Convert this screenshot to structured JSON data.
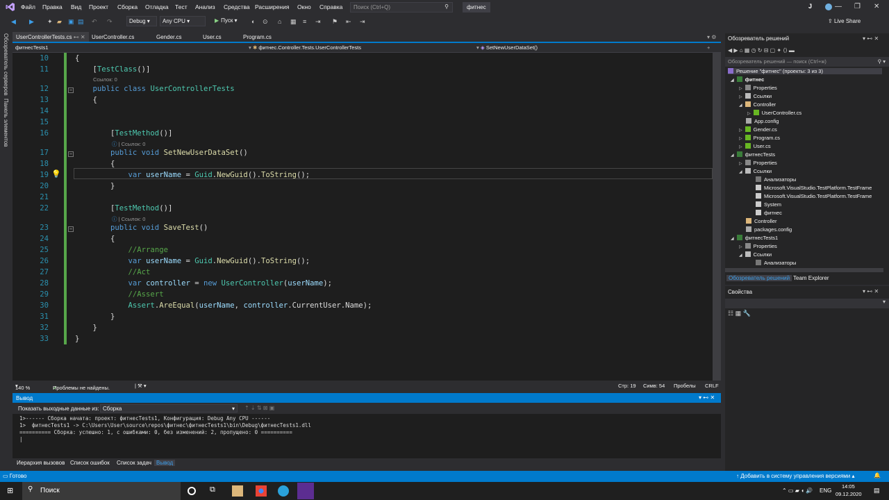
{
  "menu": {
    "items": [
      "Файл",
      "Правка",
      "Вид",
      "Проект",
      "Сборка",
      "Отладка",
      "Тест",
      "Анализ",
      "Средства",
      "Расширения",
      "Окно",
      "Справка"
    ],
    "search_placeholder": "Поиск (Ctrl+Q)",
    "project_title": "фитнес",
    "user_initial": "J"
  },
  "toolbar": {
    "config": "Debug",
    "platform": "Any CPU",
    "start": "Пуск",
    "live_share": "Live Share"
  },
  "left_tabs": [
    "Обозреватель серверов",
    "Панель элементов"
  ],
  "doc_tabs": [
    "UserControllerTests.cs",
    "UserController.cs",
    "Gender.cs",
    "User.cs",
    "Program.cs"
  ],
  "nav": {
    "project": "фитнесTests1",
    "class": "фитнес.Controller.Tests.UserControllerTests",
    "member": "SetNewUserDataSet()"
  },
  "code": {
    "line_numbers": [
      "10",
      "11",
      "12",
      "13",
      "14",
      "15",
      "16",
      "17",
      "18",
      "19",
      "20",
      "21",
      "22",
      "23",
      "24",
      "25",
      "26",
      "27",
      "28",
      "29",
      "30",
      "31",
      "32",
      "33"
    ],
    "lens_zero": "Ссылок: 0"
  },
  "editor_status": {
    "zoom": "140 %",
    "problems": "Проблемы не найдены.",
    "line": "Стр: 19",
    "col": "Симв: 54",
    "spaces": "Пробелы",
    "eol": "CRLF"
  },
  "output": {
    "title": "Вывод",
    "show_label": "Показать выходные данные из:",
    "source": "Сборка",
    "lines": [
      "1>------ Сборка начата: проект: фитнесTests1, Конфигурация: Debug Any CPU ------",
      "1>  фитнесTests1 -> C:\\Users\\User\\source\\repos\\фитнес\\фитнесTests1\\bin\\Debug\\фитнесTests1.dll",
      "========== Сборка: успешно: 1, с ошибками: 0, без изменений: 2, пропущено: 0 =========="
    ]
  },
  "bottom_tabs": [
    "Иерархия вызовов",
    "Список ошибок",
    "Список задач",
    "Вывод"
  ],
  "solution_explorer": {
    "title": "Обозреватель решений",
    "search_placeholder": "Обозреватель решений — поиск (Ctrl+ж)",
    "items": [
      {
        "label": "Решение \"фитнес\" (проекты: 3 из 3)"
      },
      {
        "label": "фитнес"
      },
      {
        "label": "Properties"
      },
      {
        "label": "Ссылки"
      },
      {
        "label": "Controller"
      },
      {
        "label": "UserController.cs"
      },
      {
        "label": "App.config"
      },
      {
        "label": "Gender.cs"
      },
      {
        "label": "Program.cs"
      },
      {
        "label": "User.cs"
      },
      {
        "label": "фитнесTests"
      },
      {
        "label": "Properties"
      },
      {
        "label": "Ссылки"
      },
      {
        "label": "Анализаторы"
      },
      {
        "label": "Microsoft.VisualStudio.TestPlatform.TestFrame"
      },
      {
        "label": "Microsoft.VisualStudio.TestPlatform.TestFrame"
      },
      {
        "label": "System"
      },
      {
        "label": "фитнес"
      },
      {
        "label": "Controller"
      },
      {
        "label": "packages.config"
      },
      {
        "label": "фитнесTests1"
      },
      {
        "label": "Properties"
      },
      {
        "label": "Ссылки"
      },
      {
        "label": "Анализаторы"
      }
    ],
    "tabs": [
      "Обозреватель решений",
      "Team Explorer"
    ]
  },
  "properties": {
    "title": "Свойства"
  },
  "status_bar": {
    "ready": "Готово",
    "vcs": "Добавить в систему управления версиями"
  },
  "taskbar": {
    "search": "Поиск",
    "lang": "ENG",
    "time": "14:05",
    "date": "09.12.2020"
  }
}
